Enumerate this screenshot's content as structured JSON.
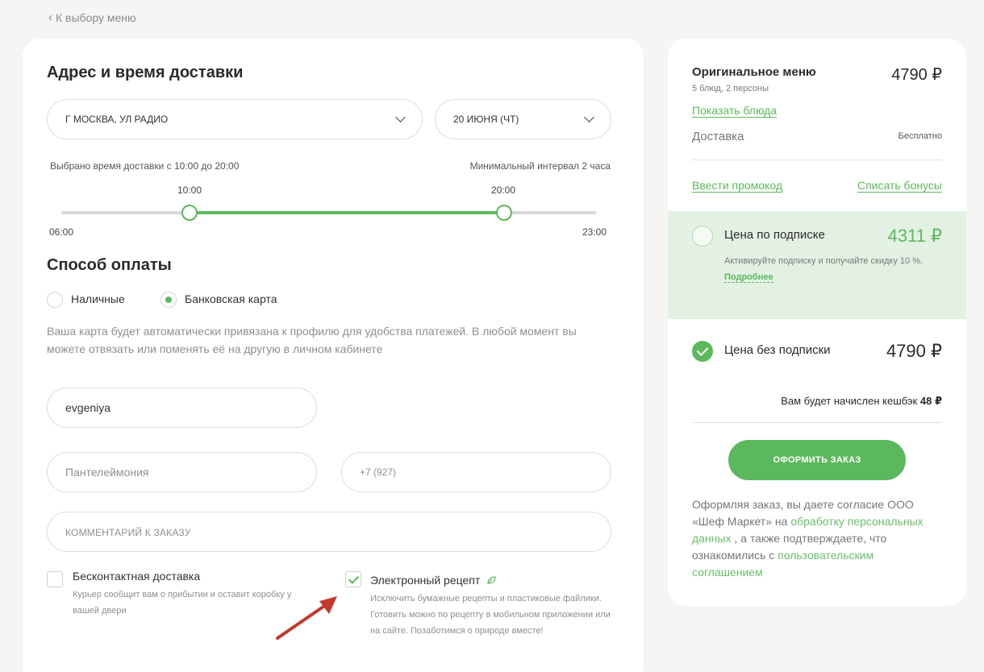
{
  "nav": {
    "back_label": "К выбору меню"
  },
  "delivery": {
    "title": "Адрес и время доставки",
    "address_value": "г Москва, ул Радио",
    "date_value": "20 июня (чт)",
    "selected_time_text": "Выбрано время доставки с 10:00 до 20:00",
    "min_interval_text": "Минимальный интервал 2 часа",
    "slider": {
      "range_min": "06:00",
      "range_max": "23:00",
      "from_label": "10:00",
      "to_label": "20:00",
      "from_value": 10,
      "to_value": 20,
      "min_value": 6,
      "max_value": 23
    }
  },
  "payment": {
    "title": "Способ оплаты",
    "options": [
      {
        "label": "Наличные",
        "checked": false
      },
      {
        "label": "Банковская карта",
        "checked": true
      }
    ],
    "card_hint": "Ваша карта будет автоматически привязана к профилю для удобства платежей. В любой момент вы можете отвязать или поменять её на другую в личном кабинете"
  },
  "form": {
    "first_name_value": "evgeniya",
    "last_name_placeholder": "Пантелеймония",
    "phone_placeholder": "+7 (927)",
    "comment_placeholder": "Комментарий к заказу"
  },
  "extras": {
    "contactless": {
      "title": "Бесконтактная доставка",
      "desc": "Курьер сообщит вам о прибытии и оставит коробку у вашей двери",
      "checked": false
    },
    "e_recipe": {
      "title": "Электронный рецепт",
      "desc": "Исключить бумажные рецепты и пластиковые файлики. Готовить можно по рецепту в мобильном приложении или на сайте. Позаботимся о природе вместе!",
      "checked": true,
      "icon": "leaf-icon"
    }
  },
  "summary": {
    "menu_title": "Оригинальное меню",
    "menu_price": "4790 ₽",
    "menu_sub": "5 блюд, 2 персоны",
    "show_dishes_link": "Показать блюда",
    "delivery_label": "Доставка",
    "delivery_value": "Бесплатно",
    "promo_link": "Ввести промокод",
    "bonus_link": "Списать бонусы",
    "subscription": {
      "label": "Цена по подписке",
      "price": "4311 ₽",
      "desc": "Активируйте подписку и получайте скидку 10 %.",
      "more_link": "Подробнее",
      "checked": false
    },
    "no_subscription": {
      "label": "Цена без подписки",
      "price": "4790 ₽",
      "checked": true
    },
    "cashback_text": "Вам будет начислен кешбэк",
    "cashback_value": "48 ₽",
    "order_button": "ОФОРМИТЬ ЗАКАЗ",
    "agreement": {
      "part1": "Оформляя заказ, вы даете согласие ООО «Шеф Маркет» на ",
      "link1": "обработку персональных данных",
      "part2": " , а также подтверждаете, что ознакомились с ",
      "link2": "пользовательским соглашением"
    }
  },
  "colors": {
    "accent": "#5cb85c",
    "subscription_bg": "#e3f1e3",
    "annotation_arrow": "#c0392b"
  }
}
